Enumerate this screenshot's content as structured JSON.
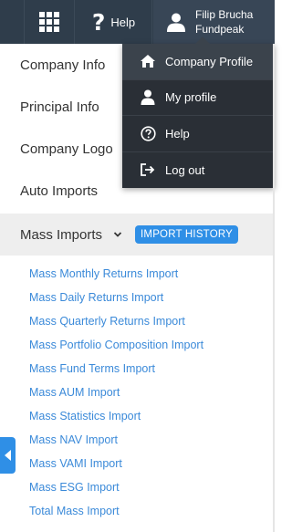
{
  "topbar": {
    "apps_icon": "apps-grid-icon",
    "help_icon": "question-icon",
    "help_label": "Help",
    "user_icon": "user-icon",
    "user_name": "Filip Brucha",
    "company_name": "Fundpeak"
  },
  "nav": {
    "items": [
      {
        "label": "Company Info"
      },
      {
        "label": "Principal Info"
      },
      {
        "label": "Company Logo"
      },
      {
        "label": "Auto Imports"
      }
    ],
    "active": {
      "label": "Mass Imports",
      "chevron_icon": "chevron-down-icon",
      "history_button": "IMPORT HISTORY"
    }
  },
  "sublist": [
    "Mass Monthly Returns Import",
    "Mass Daily Returns Import",
    "Mass Quarterly Returns Import",
    "Mass Portfolio Composition Import",
    "Mass Fund Terms Import",
    "Mass AUM Import",
    "Mass Statistics Import",
    "Mass NAV Import",
    "Mass VAMI Import",
    "Mass ESG Import",
    "Total Mass Import"
  ],
  "dropdown": {
    "items": [
      {
        "label": "Company Profile",
        "icon": "home-icon"
      },
      {
        "label": "My profile",
        "icon": "user-icon"
      },
      {
        "label": "Help",
        "icon": "help-circle-icon"
      },
      {
        "label": "Log out",
        "icon": "logout-icon"
      }
    ]
  },
  "side_toggle_icon": "caret-left-icon",
  "colors": {
    "topbar": "#2f3d4b",
    "dropdown": "#2a2f36",
    "accent": "#2f8fe6",
    "link": "#3b8ad9"
  }
}
